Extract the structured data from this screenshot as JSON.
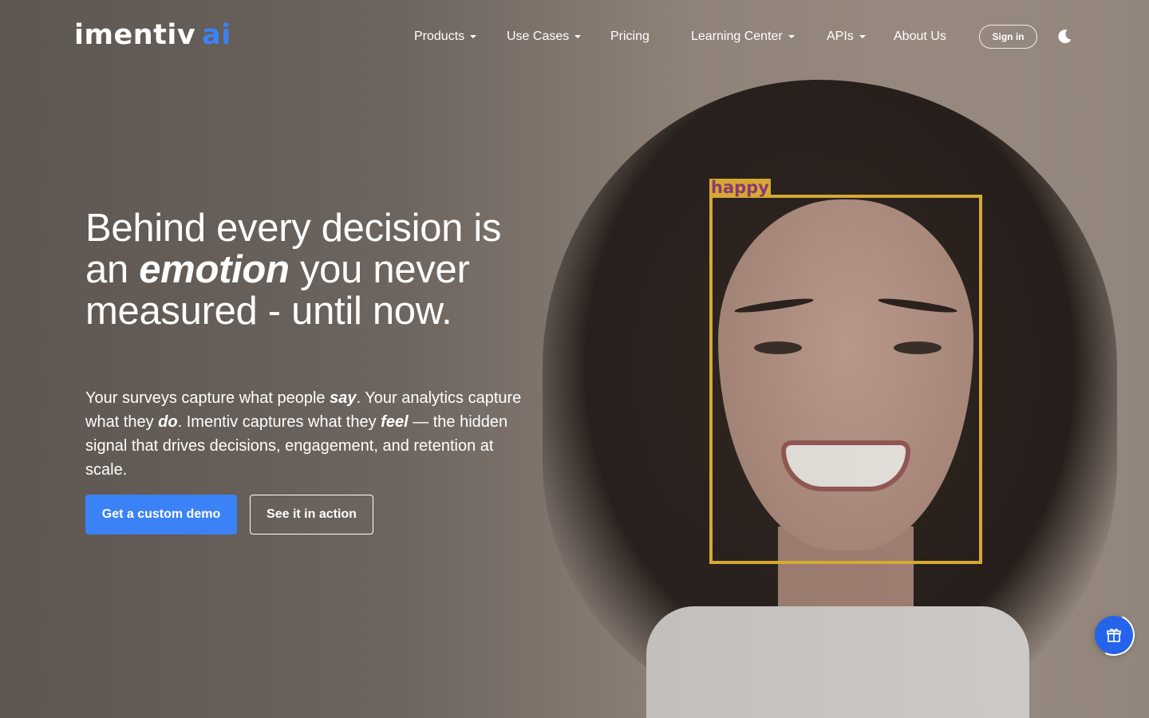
{
  "brand": {
    "name": "imentiv",
    "suffix": "ai"
  },
  "nav": {
    "items": [
      {
        "label": "Products",
        "dropdown": true
      },
      {
        "label": "Use Cases",
        "dropdown": true
      },
      {
        "label": "Pricing",
        "dropdown": false
      },
      {
        "label": "Learning Center",
        "dropdown": true
      },
      {
        "label": "APIs",
        "dropdown": true
      },
      {
        "label": "About Us",
        "dropdown": false
      }
    ],
    "signin_label": "Sign in",
    "theme_toggle_icon": "moon-icon"
  },
  "hero": {
    "headline_part1": "Behind every decision is an ",
    "headline_emphasis": "emotion",
    "headline_part2": " you never measured - until now.",
    "sub_1": "Your surveys capture what people ",
    "sub_say": "say",
    "sub_2": ". Your analytics capture what they ",
    "sub_do": "do",
    "sub_3": ". Imentiv captures what they ",
    "sub_feel": "feel",
    "sub_4": " — the hidden signal that drives decisions, engagement, and retention at scale.",
    "cta_primary": "Get a custom demo",
    "cta_secondary": "See it in action"
  },
  "detection": {
    "label": "happy"
  },
  "colors": {
    "accent": "#3b82f6",
    "detect_box": "#d4a934",
    "detect_text": "#8b3a6e"
  },
  "floating_button": {
    "icon": "gift-icon"
  }
}
